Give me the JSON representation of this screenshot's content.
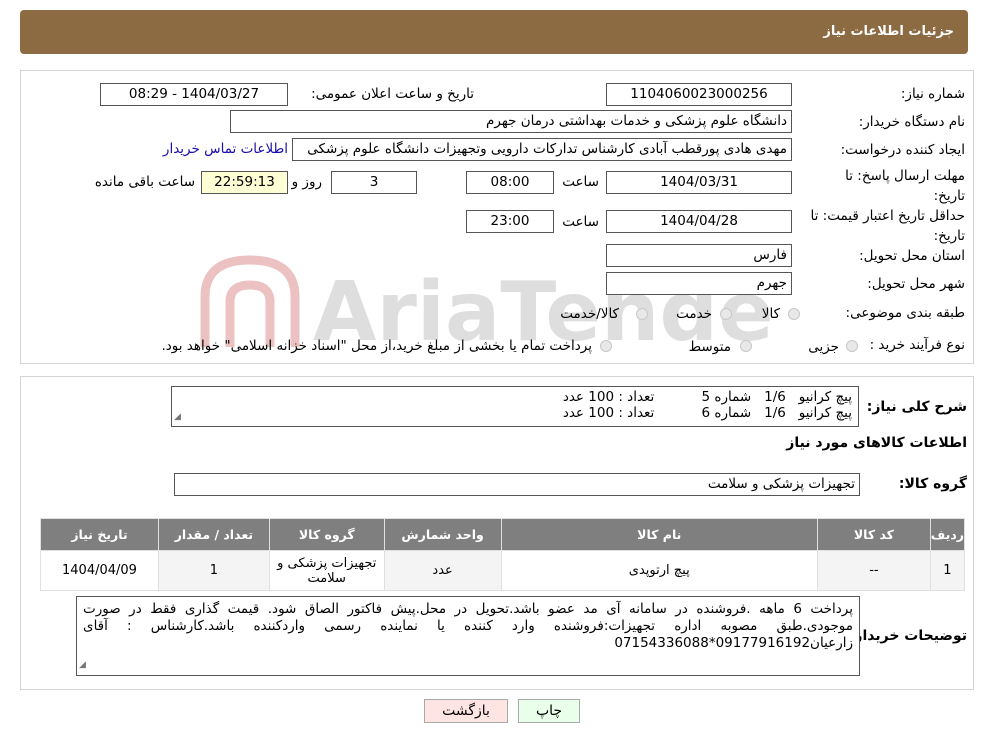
{
  "header": {
    "title": "جزئیات اطلاعات نیاز"
  },
  "form": {
    "need_number_label": "شماره نیاز:",
    "need_number": "1104060023000256",
    "announce_label": "تاریخ و ساعت اعلان عمومی:",
    "announce_value": "1404/03/27 - 08:29",
    "buyer_label": "نام دستگاه خریدار:",
    "buyer_value": "دانشگاه علوم پزشکی و خدمات بهداشتی  درمان جهرم",
    "creator_label": "ایجاد کننده درخواست:",
    "creator_value": "مهدی هادی پورقطب آبادی کارشناس تداركات دارویی وتجهیزات دانشگاه علوم پزشکی",
    "contact_link": "اطلاعات تماس خریدار",
    "deadline_label": "مهلت ارسال پاسخ: تا تاریخ:",
    "deadline_date": "1404/03/31",
    "time_label": "ساعت",
    "deadline_time": "08:00",
    "days_value": "3",
    "days_label": "روز و",
    "remaining_time": "22:59:13",
    "remaining_label": "ساعت باقی مانده",
    "validity_label": "حداقل تاریخ اعتبار قیمت: تا تاریخ:",
    "validity_date": "1404/04/28",
    "validity_time": "23:00",
    "province_label": "استان محل تحویل:",
    "province_value": "فارس",
    "city_label": "شهر محل تحویل:",
    "city_value": "جهرم",
    "category_label": "طبقه بندی موضوعی:",
    "category_options": [
      "کالا",
      "خدمت",
      "کالا/خدمت"
    ],
    "process_label": "نوع فرآیند خرید :",
    "process_options": [
      "جزیی",
      "متوسط"
    ],
    "process_note": "پرداخت تمام یا بخشی از مبلغ خرید،از محل \"اسناد خزانه اسلامی\" خواهد بود."
  },
  "watermark": {
    "text": "AriaTender.neT"
  },
  "details": {
    "summary_label": "شرح کلی نیاز:",
    "summary_lines": [
      "پیچ کرانیو   1/6   شماره 5           تعداد : 100 عدد",
      "پیچ کرانیو   1/6   شماره 6           تعداد : 100 عدد"
    ],
    "items_title": "اطلاعات کالاهای مورد نیاز",
    "group_label": "گروه کالا:",
    "group_value": "تجهیزات پزشکی و سلامت",
    "table": {
      "headers": [
        "ردیف",
        "کد کالا",
        "نام کالا",
        "واحد شمارش",
        "گروه کالا",
        "تعداد / مقدار",
        "تاریخ نیاز"
      ],
      "rows": [
        [
          "1",
          "--",
          "پیچ ارتوپدی",
          "عدد",
          "تجهیزات پزشکی و سلامت",
          "1",
          "1404/04/09"
        ]
      ]
    },
    "notes_label": "توضیحات خریدار:",
    "notes_text": "پرداخت 6 ماهه .فروشنده در سامانه آی مد عضو باشد.تحویل در محل.پیش فاکتور الصاق شود. قیمت گذاری فقط در صورت موجودی.طبق مصوبه اداره تجهیزات:فروشنده وارد کننده یا نماینده رسمی واردکننده باشد.کارشناس : آقای زارعیان09177916192*07154336088"
  },
  "buttons": {
    "print": "چاپ",
    "back": "بازگشت"
  },
  "colors": {
    "header": "#8c6a42",
    "table_header": "#7f7f7f",
    "link": "#1a0dab"
  }
}
